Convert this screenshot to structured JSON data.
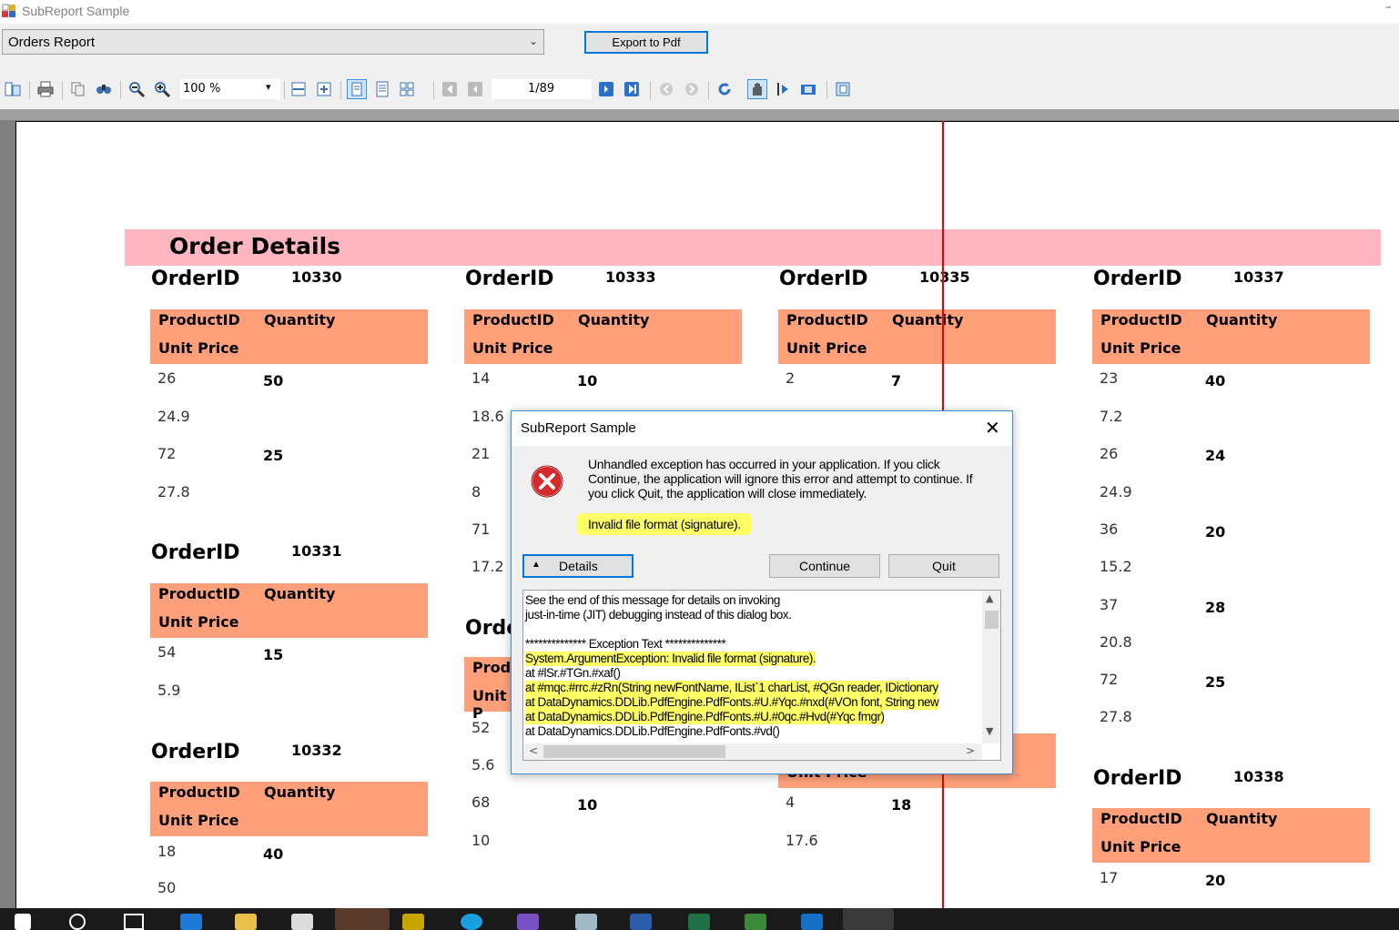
{
  "window": {
    "title": "SubReport Sample",
    "minimize_glyph": "–",
    "icon": "app-icon"
  },
  "report_select": {
    "value": "Orders Report",
    "chevron": "⌄"
  },
  "export_button": {
    "label": "Export to Pdf"
  },
  "toolbar": {
    "zoom": "100 %",
    "zoom_arrow": "▾",
    "page": "1/89",
    "icons": [
      "toc-icon",
      "print-icon",
      "copy-icon",
      "find-icon",
      "zoom-out-icon",
      "zoom-in-icon",
      "fit-width-icon",
      "fit-page-icon",
      "single-page-icon",
      "continuous-icon",
      "multi-page-icon",
      "first-page-icon",
      "prev-page-icon",
      "next-page-icon",
      "last-page-icon",
      "back-icon",
      "forward-icon",
      "refresh-icon",
      "hand-tool-icon",
      "select-tool-icon",
      "snapshot-icon",
      "galley-icon"
    ]
  },
  "report": {
    "header": "Order Details",
    "orderid_label": "OrderID",
    "productid_label": "ProductID",
    "quantity_label": "Quantity",
    "unitprice_label": "Unit Price",
    "col1": {
      "o1": {
        "id": "10330",
        "rows": [
          [
            "26",
            "50",
            "24.9"
          ],
          [
            "72",
            "25",
            "27.8"
          ]
        ]
      },
      "o2": {
        "id": "10331",
        "rows": [
          [
            "54",
            "15",
            "5.9"
          ]
        ]
      },
      "o3": {
        "id": "10332",
        "rows": [
          [
            "18",
            "40",
            "50"
          ]
        ]
      }
    },
    "col2": {
      "o1": {
        "id": "10333",
        "rows": [
          [
            "14",
            "10",
            "18.6"
          ],
          [
            "21",
            "",
            ""
          ],
          [
            "8",
            "",
            ""
          ],
          [
            "71",
            "",
            ""
          ],
          [
            "17.2",
            "",
            ""
          ]
        ]
      },
      "o2_partial_label": "Orde",
      "o2_pid_partial": "Produ",
      "o2_up_partial": "Unit P",
      "o2_rows": [
        [
          "52",
          "",
          ""
        ],
        [
          "5.6",
          "",
          ""
        ],
        [
          "68",
          "10",
          "10"
        ]
      ]
    },
    "col3": {
      "o1": {
        "id": "10335",
        "rows": [
          [
            "2",
            "7"
          ]
        ]
      },
      "o2_partial_up": "Unit Price",
      "o2_rows": [
        [
          "4",
          "18",
          "17.6"
        ]
      ]
    },
    "col4": {
      "o1": {
        "id": "10337",
        "rows": [
          [
            "23",
            "40",
            "7.2"
          ],
          [
            "26",
            "24",
            "24.9"
          ],
          [
            "36",
            "20",
            "15.2"
          ],
          [
            "37",
            "28",
            "20.8"
          ],
          [
            "72",
            "25",
            "27.8"
          ]
        ]
      },
      "o2": {
        "id": "10338",
        "rows": [
          [
            "17",
            "20"
          ]
        ]
      }
    }
  },
  "dialog": {
    "title": "SubReport Sample",
    "close_glyph": "✕",
    "message": "Unhandled exception has occurred in your application. If you click Continue, the application will ignore this error and attempt to continue. If you click Quit, the application will close immediately.",
    "error": "Invalid file format (signature).",
    "details_arrow": "▲",
    "details_label": "Details",
    "continue_label": "Continue",
    "quit_label": "Quit",
    "details_lines": [
      "See the end of this message for details on invoking",
      "just-in-time (JIT) debugging instead of this dialog box.",
      "",
      "************** Exception Text **************",
      "System.ArgumentException: Invalid file format (signature).",
      "   at #lSr.#TGn.#xaf()",
      "   at #mqc.#rrc.#zRn(String newFontName, IList`1 charList, #QGn reader, IDictionary",
      "   at DataDynamics.DDLib.PdfEngine.PdfFonts.#U.#Yqc.#nxd(#VOn font, String new",
      "   at DataDynamics.DDLib.PdfEngine.PdfFonts.#U.#0qc.#Hvd(#Yqc fmgr)",
      "   at DataDynamics.DDLib.PdfEngine.PdfFonts.#vd()"
    ],
    "scroll_up": "▲",
    "scroll_down": "▼",
    "scroll_left": "<",
    "scroll_right": ">"
  },
  "colors": {
    "header_band": "#ffb6c1",
    "group_band": "#ffa07a",
    "highlight": "#ffff66",
    "accent": "#0078d7"
  }
}
